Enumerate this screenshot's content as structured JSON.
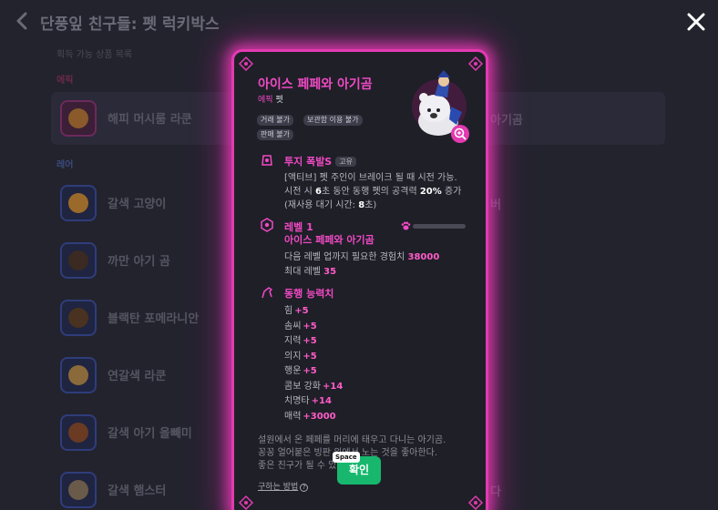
{
  "header": {
    "title": "단풍잎 친구들: 펫 럭키박스",
    "subtitle": "획득 가능 상품 목록"
  },
  "categories": {
    "epic": "에픽",
    "rare": "레어"
  },
  "pets": [
    {
      "name": "해피 머시룸 라쿤",
      "right": "아기곰"
    },
    {
      "name": "갈색 고양이",
      "right": "버"
    },
    {
      "name": "까만 아기 곰",
      "right": ""
    },
    {
      "name": "블랙탄 포메라니안",
      "right": ""
    },
    {
      "name": "연갈색 라쿤",
      "right": ""
    },
    {
      "name": "갈색 아기 올빼미",
      "right": ""
    },
    {
      "name": "갈색 햄스터",
      "right": "다"
    }
  ],
  "modal": {
    "title": "아이스 페페와 아기곰",
    "grade": "에픽",
    "grade_type": "펫",
    "tags": [
      "거래 불가",
      "보관함 이용 불가",
      "판매 불가"
    ],
    "skill": {
      "title": "투지 폭발S",
      "badge": "고유",
      "line1": "[액티브] 펫 주인이 브레이크 될 때 시전 가능.",
      "line2_a": "시전 시 ",
      "line2_b": "6",
      "line2_c": "초 동안 동행 펫의 공격력 ",
      "line2_d": "20%",
      "line2_e": " 증가",
      "line3_a": "(재사용 대기 시간: ",
      "line3_b": "8",
      "line3_c": "초)"
    },
    "level": {
      "title": "레벨 1",
      "name": "아이스 페페와 아기곰",
      "exp_label": "다음 레벨 업까지 필요한 경험치",
      "exp_value": "38000",
      "max_label": "최대 레벨",
      "max_value": "35",
      "exp_progress": 0
    },
    "stats": {
      "title": "동행 능력치",
      "items": [
        {
          "label": "힘",
          "value": "+5"
        },
        {
          "label": "솜씨",
          "value": "+5"
        },
        {
          "label": "지력",
          "value": "+5"
        },
        {
          "label": "의지",
          "value": "+5"
        },
        {
          "label": "행운",
          "value": "+5"
        },
        {
          "label": "콤보 강화",
          "value": "+14"
        },
        {
          "label": "치명타",
          "value": "+14"
        },
        {
          "label": "매력",
          "value": "+3000"
        }
      ]
    },
    "desc": [
      "설원에서 온 페페를 머리에 태우고 다니는 아기곰.",
      "꽁꽁 얼어붙은 빙판 위에서 노는 것을 좋아한다.",
      "좋은 친구가 될 수 있"
    ],
    "howto": "구하는 방법",
    "confirm": "확인",
    "key_hint": "Space"
  },
  "colors": {
    "accent": "#e23ab0",
    "confirm": "#17b86e"
  }
}
